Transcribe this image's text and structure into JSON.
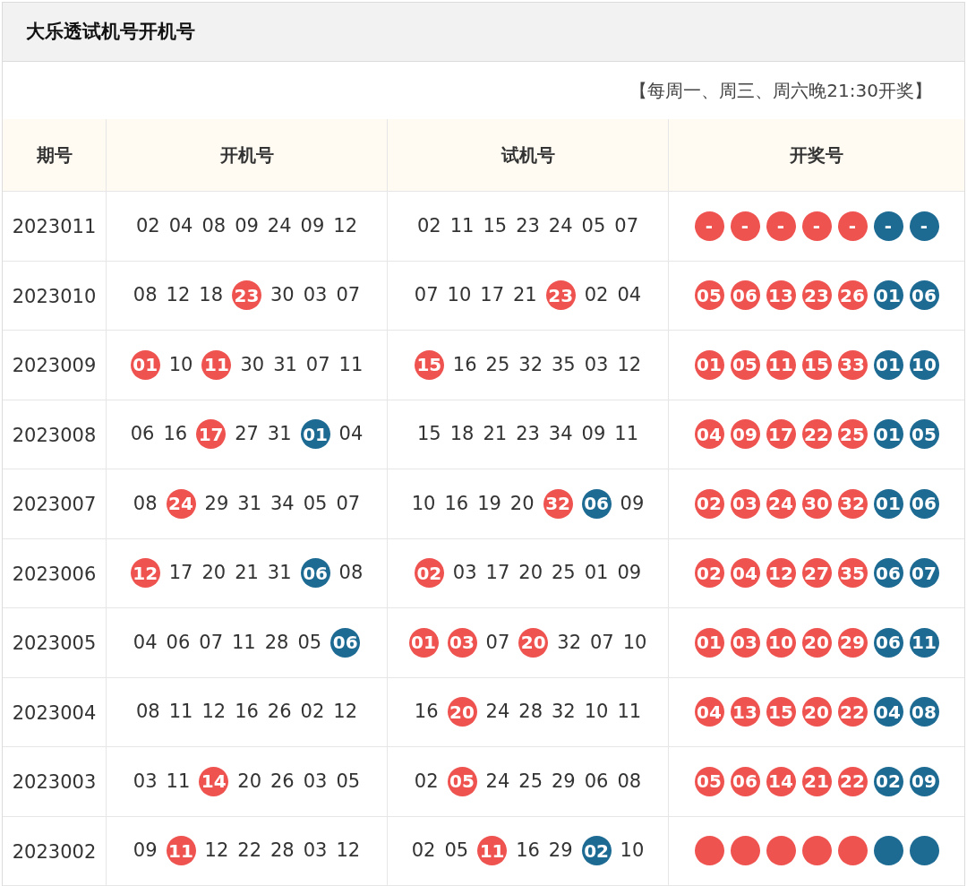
{
  "title": "大乐透试机号开机号",
  "note": "【每周一、周三、周六晚21:30开奖】",
  "columns": [
    "期号",
    "开机号",
    "试机号",
    "开奖号"
  ],
  "rows": [
    {
      "period": "2023011",
      "open": [
        {
          "text": "02",
          "kind": "plain"
        },
        {
          "text": "04",
          "kind": "plain"
        },
        {
          "text": "08",
          "kind": "plain"
        },
        {
          "text": "09",
          "kind": "plain"
        },
        {
          "text": "24",
          "kind": "plain"
        },
        {
          "text": "09",
          "kind": "plain"
        },
        {
          "text": "12",
          "kind": "plain"
        }
      ],
      "trial": [
        {
          "text": "02",
          "kind": "plain"
        },
        {
          "text": "11",
          "kind": "plain"
        },
        {
          "text": "15",
          "kind": "plain"
        },
        {
          "text": "23",
          "kind": "plain"
        },
        {
          "text": "24",
          "kind": "plain"
        },
        {
          "text": "05",
          "kind": "plain"
        },
        {
          "text": "07",
          "kind": "plain"
        }
      ],
      "draw": [
        {
          "text": "-",
          "kind": "red"
        },
        {
          "text": "-",
          "kind": "red"
        },
        {
          "text": "-",
          "kind": "red"
        },
        {
          "text": "-",
          "kind": "red"
        },
        {
          "text": "-",
          "kind": "red"
        },
        {
          "text": "-",
          "kind": "blue"
        },
        {
          "text": "-",
          "kind": "blue"
        }
      ]
    },
    {
      "period": "2023010",
      "open": [
        {
          "text": "08",
          "kind": "plain"
        },
        {
          "text": "12",
          "kind": "plain"
        },
        {
          "text": "18",
          "kind": "plain"
        },
        {
          "text": "23",
          "kind": "red"
        },
        {
          "text": "30",
          "kind": "plain"
        },
        {
          "text": "03",
          "kind": "plain"
        },
        {
          "text": "07",
          "kind": "plain"
        }
      ],
      "trial": [
        {
          "text": "07",
          "kind": "plain"
        },
        {
          "text": "10",
          "kind": "plain"
        },
        {
          "text": "17",
          "kind": "plain"
        },
        {
          "text": "21",
          "kind": "plain"
        },
        {
          "text": "23",
          "kind": "red"
        },
        {
          "text": "02",
          "kind": "plain"
        },
        {
          "text": "04",
          "kind": "plain"
        }
      ],
      "draw": [
        {
          "text": "05",
          "kind": "red"
        },
        {
          "text": "06",
          "kind": "red"
        },
        {
          "text": "13",
          "kind": "red"
        },
        {
          "text": "23",
          "kind": "red"
        },
        {
          "text": "26",
          "kind": "red"
        },
        {
          "text": "01",
          "kind": "blue"
        },
        {
          "text": "06",
          "kind": "blue"
        }
      ]
    },
    {
      "period": "2023009",
      "open": [
        {
          "text": "01",
          "kind": "red"
        },
        {
          "text": "10",
          "kind": "plain"
        },
        {
          "text": "11",
          "kind": "red"
        },
        {
          "text": "30",
          "kind": "plain"
        },
        {
          "text": "31",
          "kind": "plain"
        },
        {
          "text": "07",
          "kind": "plain"
        },
        {
          "text": "11",
          "kind": "plain"
        }
      ],
      "trial": [
        {
          "text": "15",
          "kind": "red"
        },
        {
          "text": "16",
          "kind": "plain"
        },
        {
          "text": "25",
          "kind": "plain"
        },
        {
          "text": "32",
          "kind": "plain"
        },
        {
          "text": "35",
          "kind": "plain"
        },
        {
          "text": "03",
          "kind": "plain"
        },
        {
          "text": "12",
          "kind": "plain"
        }
      ],
      "draw": [
        {
          "text": "01",
          "kind": "red"
        },
        {
          "text": "05",
          "kind": "red"
        },
        {
          "text": "11",
          "kind": "red"
        },
        {
          "text": "15",
          "kind": "red"
        },
        {
          "text": "33",
          "kind": "red"
        },
        {
          "text": "01",
          "kind": "blue"
        },
        {
          "text": "10",
          "kind": "blue"
        }
      ]
    },
    {
      "period": "2023008",
      "open": [
        {
          "text": "06",
          "kind": "plain"
        },
        {
          "text": "16",
          "kind": "plain"
        },
        {
          "text": "17",
          "kind": "red"
        },
        {
          "text": "27",
          "kind": "plain"
        },
        {
          "text": "31",
          "kind": "plain"
        },
        {
          "text": "01",
          "kind": "blue"
        },
        {
          "text": "04",
          "kind": "plain"
        }
      ],
      "trial": [
        {
          "text": "15",
          "kind": "plain"
        },
        {
          "text": "18",
          "kind": "plain"
        },
        {
          "text": "21",
          "kind": "plain"
        },
        {
          "text": "23",
          "kind": "plain"
        },
        {
          "text": "34",
          "kind": "plain"
        },
        {
          "text": "09",
          "kind": "plain"
        },
        {
          "text": "11",
          "kind": "plain"
        }
      ],
      "draw": [
        {
          "text": "04",
          "kind": "red"
        },
        {
          "text": "09",
          "kind": "red"
        },
        {
          "text": "17",
          "kind": "red"
        },
        {
          "text": "22",
          "kind": "red"
        },
        {
          "text": "25",
          "kind": "red"
        },
        {
          "text": "01",
          "kind": "blue"
        },
        {
          "text": "05",
          "kind": "blue"
        }
      ]
    },
    {
      "period": "2023007",
      "open": [
        {
          "text": "08",
          "kind": "plain"
        },
        {
          "text": "24",
          "kind": "red"
        },
        {
          "text": "29",
          "kind": "plain"
        },
        {
          "text": "31",
          "kind": "plain"
        },
        {
          "text": "34",
          "kind": "plain"
        },
        {
          "text": "05",
          "kind": "plain"
        },
        {
          "text": "07",
          "kind": "plain"
        }
      ],
      "trial": [
        {
          "text": "10",
          "kind": "plain"
        },
        {
          "text": "16",
          "kind": "plain"
        },
        {
          "text": "19",
          "kind": "plain"
        },
        {
          "text": "20",
          "kind": "plain"
        },
        {
          "text": "32",
          "kind": "red"
        },
        {
          "text": "06",
          "kind": "blue"
        },
        {
          "text": "09",
          "kind": "plain"
        }
      ],
      "draw": [
        {
          "text": "02",
          "kind": "red"
        },
        {
          "text": "03",
          "kind": "red"
        },
        {
          "text": "24",
          "kind": "red"
        },
        {
          "text": "30",
          "kind": "red"
        },
        {
          "text": "32",
          "kind": "red"
        },
        {
          "text": "01",
          "kind": "blue"
        },
        {
          "text": "06",
          "kind": "blue"
        }
      ]
    },
    {
      "period": "2023006",
      "open": [
        {
          "text": "12",
          "kind": "red"
        },
        {
          "text": "17",
          "kind": "plain"
        },
        {
          "text": "20",
          "kind": "plain"
        },
        {
          "text": "21",
          "kind": "plain"
        },
        {
          "text": "31",
          "kind": "plain"
        },
        {
          "text": "06",
          "kind": "blue"
        },
        {
          "text": "08",
          "kind": "plain"
        }
      ],
      "trial": [
        {
          "text": "02",
          "kind": "red"
        },
        {
          "text": "03",
          "kind": "plain"
        },
        {
          "text": "17",
          "kind": "plain"
        },
        {
          "text": "20",
          "kind": "plain"
        },
        {
          "text": "25",
          "kind": "plain"
        },
        {
          "text": "01",
          "kind": "plain"
        },
        {
          "text": "09",
          "kind": "plain"
        }
      ],
      "draw": [
        {
          "text": "02",
          "kind": "red"
        },
        {
          "text": "04",
          "kind": "red"
        },
        {
          "text": "12",
          "kind": "red"
        },
        {
          "text": "27",
          "kind": "red"
        },
        {
          "text": "35",
          "kind": "red"
        },
        {
          "text": "06",
          "kind": "blue"
        },
        {
          "text": "07",
          "kind": "blue"
        }
      ]
    },
    {
      "period": "2023005",
      "open": [
        {
          "text": "04",
          "kind": "plain"
        },
        {
          "text": "06",
          "kind": "plain"
        },
        {
          "text": "07",
          "kind": "plain"
        },
        {
          "text": "11",
          "kind": "plain"
        },
        {
          "text": "28",
          "kind": "plain"
        },
        {
          "text": "05",
          "kind": "plain"
        },
        {
          "text": "06",
          "kind": "blue"
        }
      ],
      "trial": [
        {
          "text": "01",
          "kind": "red"
        },
        {
          "text": "03",
          "kind": "red"
        },
        {
          "text": "07",
          "kind": "plain"
        },
        {
          "text": "20",
          "kind": "red"
        },
        {
          "text": "32",
          "kind": "plain"
        },
        {
          "text": "07",
          "kind": "plain"
        },
        {
          "text": "10",
          "kind": "plain"
        }
      ],
      "draw": [
        {
          "text": "01",
          "kind": "red"
        },
        {
          "text": "03",
          "kind": "red"
        },
        {
          "text": "10",
          "kind": "red"
        },
        {
          "text": "20",
          "kind": "red"
        },
        {
          "text": "29",
          "kind": "red"
        },
        {
          "text": "06",
          "kind": "blue"
        },
        {
          "text": "11",
          "kind": "blue"
        }
      ]
    },
    {
      "period": "2023004",
      "open": [
        {
          "text": "08",
          "kind": "plain"
        },
        {
          "text": "11",
          "kind": "plain"
        },
        {
          "text": "12",
          "kind": "plain"
        },
        {
          "text": "16",
          "kind": "plain"
        },
        {
          "text": "26",
          "kind": "plain"
        },
        {
          "text": "02",
          "kind": "plain"
        },
        {
          "text": "12",
          "kind": "plain"
        }
      ],
      "trial": [
        {
          "text": "16",
          "kind": "plain"
        },
        {
          "text": "20",
          "kind": "red"
        },
        {
          "text": "24",
          "kind": "plain"
        },
        {
          "text": "28",
          "kind": "plain"
        },
        {
          "text": "32",
          "kind": "plain"
        },
        {
          "text": "10",
          "kind": "plain"
        },
        {
          "text": "11",
          "kind": "plain"
        }
      ],
      "draw": [
        {
          "text": "04",
          "kind": "red"
        },
        {
          "text": "13",
          "kind": "red"
        },
        {
          "text": "15",
          "kind": "red"
        },
        {
          "text": "20",
          "kind": "red"
        },
        {
          "text": "22",
          "kind": "red"
        },
        {
          "text": "04",
          "kind": "blue"
        },
        {
          "text": "08",
          "kind": "blue"
        }
      ]
    },
    {
      "period": "2023003",
      "open": [
        {
          "text": "03",
          "kind": "plain"
        },
        {
          "text": "11",
          "kind": "plain"
        },
        {
          "text": "14",
          "kind": "red"
        },
        {
          "text": "20",
          "kind": "plain"
        },
        {
          "text": "26",
          "kind": "plain"
        },
        {
          "text": "03",
          "kind": "plain"
        },
        {
          "text": "05",
          "kind": "plain"
        }
      ],
      "trial": [
        {
          "text": "02",
          "kind": "plain"
        },
        {
          "text": "05",
          "kind": "red"
        },
        {
          "text": "24",
          "kind": "plain"
        },
        {
          "text": "25",
          "kind": "plain"
        },
        {
          "text": "29",
          "kind": "plain"
        },
        {
          "text": "06",
          "kind": "plain"
        },
        {
          "text": "08",
          "kind": "plain"
        }
      ],
      "draw": [
        {
          "text": "05",
          "kind": "red"
        },
        {
          "text": "06",
          "kind": "red"
        },
        {
          "text": "14",
          "kind": "red"
        },
        {
          "text": "21",
          "kind": "red"
        },
        {
          "text": "22",
          "kind": "red"
        },
        {
          "text": "02",
          "kind": "blue"
        },
        {
          "text": "09",
          "kind": "blue"
        }
      ]
    },
    {
      "period": "2023002",
      "open": [
        {
          "text": "09",
          "kind": "plain"
        },
        {
          "text": "11",
          "kind": "red"
        },
        {
          "text": "12",
          "kind": "plain"
        },
        {
          "text": "22",
          "kind": "plain"
        },
        {
          "text": "28",
          "kind": "plain"
        },
        {
          "text": "03",
          "kind": "plain"
        },
        {
          "text": "12",
          "kind": "plain"
        }
      ],
      "trial": [
        {
          "text": "02",
          "kind": "plain"
        },
        {
          "text": "05",
          "kind": "plain"
        },
        {
          "text": "11",
          "kind": "red"
        },
        {
          "text": "16",
          "kind": "plain"
        },
        {
          "text": "29",
          "kind": "plain"
        },
        {
          "text": "02",
          "kind": "blue"
        },
        {
          "text": "10",
          "kind": "plain"
        }
      ],
      "draw": [
        {
          "kind": "red"
        },
        {
          "kind": "red"
        },
        {
          "kind": "red"
        },
        {
          "kind": "red"
        },
        {
          "kind": "red"
        },
        {
          "kind": "blue"
        },
        {
          "kind": "blue"
        }
      ]
    }
  ]
}
